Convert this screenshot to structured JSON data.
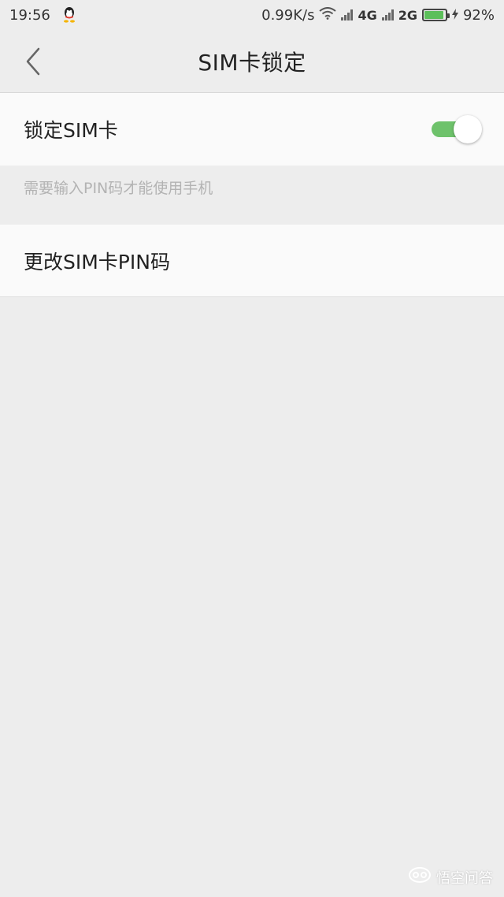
{
  "status_bar": {
    "time": "19:56",
    "speed": "0.99K/s",
    "network_1": "4G",
    "network_2": "2G",
    "battery": "92%",
    "battery_level": 0.92,
    "icons": [
      "qq-icon",
      "wifi-icon",
      "signal-icon",
      "battery-icon",
      "charging-icon"
    ]
  },
  "app_bar": {
    "title": "SIM卡锁定",
    "back_icon": "chevron-left-icon"
  },
  "settings": {
    "lock_sim": {
      "label": "锁定SIM卡",
      "enabled": true,
      "hint": "需要输入PIN码才能使用手机"
    },
    "change_pin": {
      "label": "更改SIM卡PIN码"
    }
  },
  "watermark": {
    "text": "悟空问答"
  },
  "colors": {
    "toggle_on": "#6ec26b",
    "background": "#ededed",
    "row_background": "#fafafa",
    "hint_text": "#b3b3b3"
  }
}
